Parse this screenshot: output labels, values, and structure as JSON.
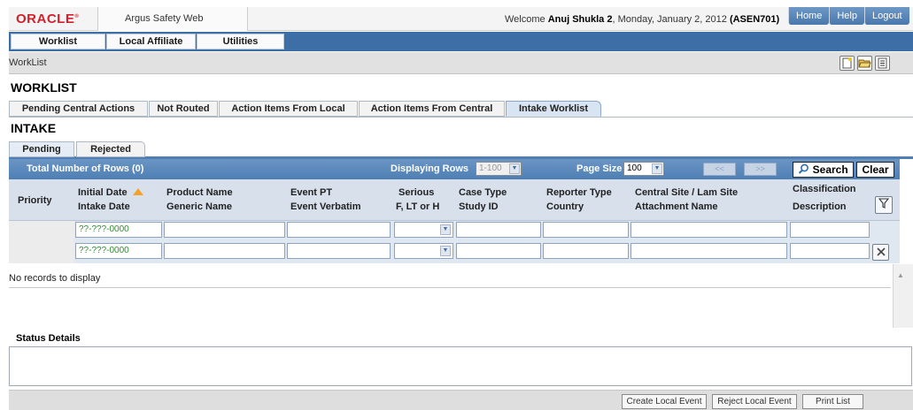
{
  "header": {
    "logo": "ORACLE",
    "app_name": "Argus Safety Web",
    "welcome_prefix": "Welcome ",
    "user": "Anuj Shukla 2",
    "date_text": ", Monday, January 2, 2012 ",
    "site_code": "(ASEN701)",
    "links": [
      "Home",
      "Help",
      "Logout"
    ]
  },
  "menu": {
    "items": [
      "Worklist",
      "Local Affiliate",
      "Utilities"
    ]
  },
  "toolbar": {
    "label": "WorkList",
    "icons": [
      "new-document-icon",
      "open-folder-icon",
      "list-view-icon"
    ]
  },
  "worklist": {
    "title": "WORKLIST",
    "tabs": [
      "Pending Central Actions",
      "Not Routed",
      "Action Items From Local",
      "Action Items From Central",
      "Intake Worklist"
    ],
    "active_tab": "Intake Worklist"
  },
  "intake": {
    "title": "INTAKE",
    "tabs": [
      "Pending",
      "Rejected"
    ],
    "active_tab": "Pending"
  },
  "gridbar": {
    "total_rows": "Total Number of Rows (0)",
    "displaying_label": "Displaying Rows",
    "displaying_value": "1-100",
    "page_size_label": "Page Size",
    "page_size_value": "100",
    "prev_label": "<<",
    "next_label": ">>",
    "search_label": "Search",
    "clear_label": "Clear"
  },
  "columns": {
    "priority": "Priority",
    "initial_date": "Initial Date",
    "intake_date": "Intake Date",
    "product_name": "Product Name",
    "generic_name": "Generic Name",
    "event_pt": "Event PT",
    "event_verbatim": "Event Verbatim",
    "serious": "Serious",
    "serious_sub": "F, LT or H",
    "case_type": "Case Type",
    "study_id": "Study ID",
    "reporter_type": "Reporter Type",
    "country": "Country",
    "central_site": "Central Site / Lam Site",
    "attachment_name": "Attachment Name",
    "classification": "Classification",
    "description": "Description"
  },
  "filters": {
    "date_from": "??-???-0000",
    "date_to": "??-???-0000"
  },
  "grid": {
    "empty_message": "No records to display"
  },
  "status": {
    "label": "Status Details"
  },
  "footer": {
    "buttons": [
      "Create Local Event",
      "Reject Local Event",
      "Print List"
    ]
  },
  "colors": {
    "brand_red": "#d4202b",
    "menu_blue": "#3d6ea5",
    "grid_bar": "#5a89bb",
    "header_bg": "#d7e0eb"
  }
}
